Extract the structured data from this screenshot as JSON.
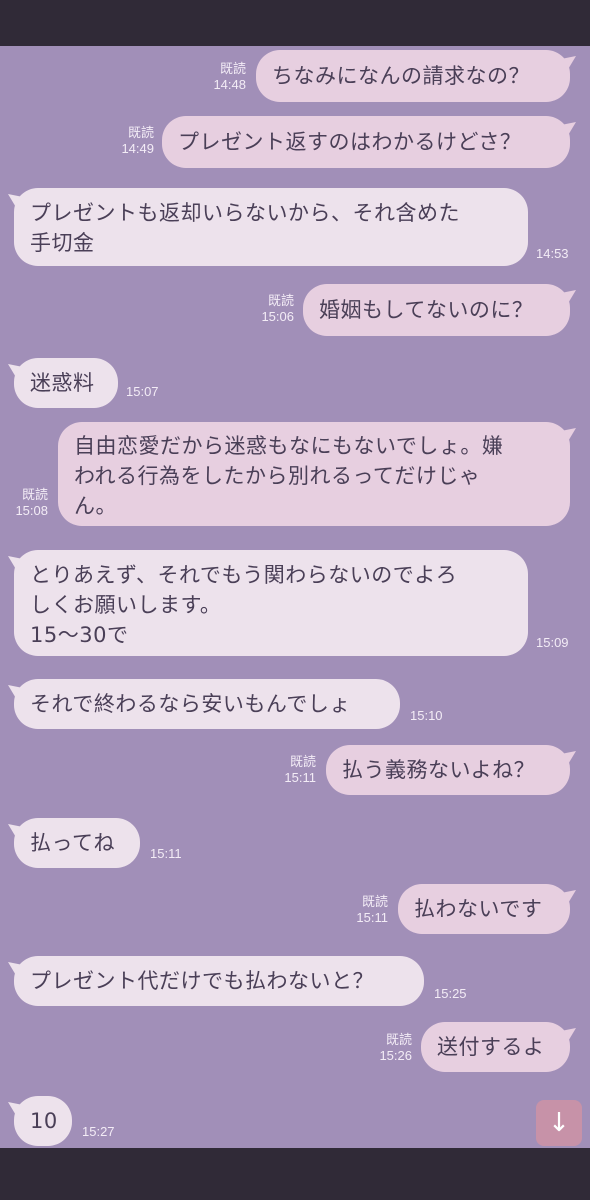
{
  "messages": [
    {
      "side": "out",
      "text": "ちなみになんの請求なの？",
      "read": "既読",
      "time": "14:48"
    },
    {
      "side": "out",
      "text": "プレゼント返すのはわかるけどさ？",
      "read": "既読",
      "time": "14:49"
    },
    {
      "side": "in",
      "text": "プレゼントも返却いらないから、それ含めた\n手切金",
      "time": "14:53"
    },
    {
      "side": "out",
      "text": "婚姻もしてないのに？",
      "read": "既読",
      "time": "15:06"
    },
    {
      "side": "in",
      "text": "迷惑料",
      "time": "15:07"
    },
    {
      "side": "out",
      "text": "自由恋愛だから迷惑もなにもないでしょ。嫌\nわれる行為をしたから別れるってだけじゃ\nん。",
      "read": "既読",
      "time": "15:08"
    },
    {
      "side": "in",
      "text": "とりあえず、それでもう関わらないのでよろ\nしくお願いします。\n15〜30で",
      "time": "15:09"
    },
    {
      "side": "in",
      "text": "それで終わるなら安いもんでしょ",
      "time": "15:10"
    },
    {
      "side": "out",
      "text": "払う義務ないよね？",
      "read": "既読",
      "time": "15:11"
    },
    {
      "side": "in",
      "text": "払ってね",
      "time": "15:11"
    },
    {
      "side": "out",
      "text": "払わないです",
      "read": "既読",
      "time": "15:11"
    },
    {
      "side": "in",
      "text": "プレゼント代だけでも払わないと？",
      "time": "15:25"
    },
    {
      "side": "out",
      "text": "送付するよ",
      "read": "既読",
      "time": "15:26"
    },
    {
      "side": "in",
      "text": "10",
      "time": "15:27"
    }
  ],
  "scroll_button": {
    "icon": "arrow-down-icon",
    "glyph": "↓"
  },
  "colors": {
    "background": "#a18fb8",
    "bars": "#302a37",
    "incoming_bubble": "#ede2ec",
    "outgoing_bubble": "#e7cfe0",
    "text": "#4a3f57",
    "meta": "#f3ecf6",
    "scroll_button": "#c792a8"
  }
}
